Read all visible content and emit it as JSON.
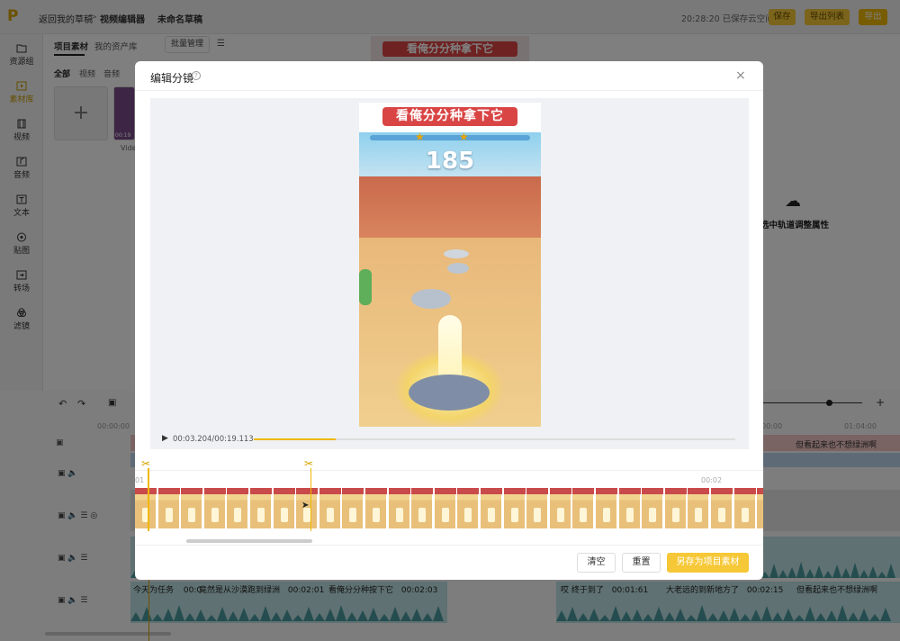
{
  "topbar": {
    "logo": "P",
    "breadcrumb": [
      "返回我的草稿",
      "视频编辑器",
      "未命名草稿"
    ],
    "separator": ">",
    "save_status": "20:28:20 已保存云空间",
    "save_label": "保存",
    "export_list_label": "导出列表",
    "export_label": "导出"
  },
  "sidebar": {
    "items": [
      {
        "label": "资源组",
        "icon": "folder-icon"
      },
      {
        "label": "素材库",
        "icon": "play-box-icon"
      },
      {
        "label": "视频",
        "icon": "film-icon"
      },
      {
        "label": "音频",
        "icon": "music-icon"
      },
      {
        "label": "文本",
        "icon": "text-icon"
      },
      {
        "label": "贴图",
        "icon": "sticker-icon"
      },
      {
        "label": "转场",
        "icon": "transition-icon"
      },
      {
        "label": "滤镜",
        "icon": "filter-icon"
      }
    ]
  },
  "library": {
    "tabs": [
      "项目素材",
      "我的资产库"
    ],
    "batch_label": "批量管理",
    "filters": [
      "全部",
      "视频",
      "音频"
    ],
    "thumb_duration": "00:19",
    "thumb_name": "Vide"
  },
  "properties": {
    "hint": "选中轨道调整属性"
  },
  "timeline": {
    "ruler": [
      "00:00:00",
      "00:00",
      "01:04:00"
    ],
    "subtitle_right": "但看起来也不想绿洲啊",
    "captions": [
      {
        "text": "今天为任务",
        "time": "00:0"
      },
      {
        "text": "竟然是从沙漠跑到绿洲",
        "time": "00:02:01"
      },
      {
        "text": "看俺分分种按下它",
        "time": "00:02:03"
      },
      {
        "text": "哎 终于到了",
        "time": "00:01:61"
      },
      {
        "text": "大老远的到新地方了",
        "time": "00:02:15"
      },
      {
        "text": "但看起来也不想绿洲啊",
        "time": ""
      }
    ]
  },
  "modal": {
    "title": "编辑分镜",
    "close_label": "×",
    "video_caption": "看俺分分种拿下它",
    "game_score": "185",
    "time_display": "00:03.204/00:19.113",
    "progress": 0.17,
    "trim": {
      "start_label": "01",
      "end_label": "00:02"
    },
    "buttons": {
      "clear": "清空",
      "reset": "重置",
      "save_as": "另存为项目素材"
    }
  },
  "colors": {
    "accent": "#f6c838",
    "accent_text": "#c79a00",
    "overlay": "rgba(0,0,0,0.5)"
  }
}
